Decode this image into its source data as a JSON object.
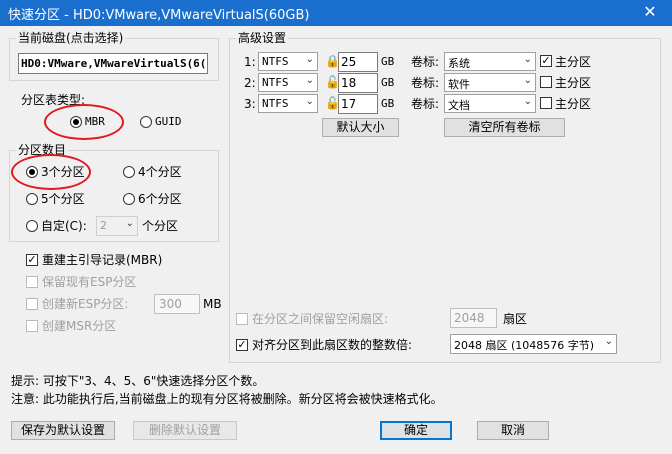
{
  "window": {
    "title": "快速分区 - HD0:VMware,VMwareVirtualS(60GB)",
    "close_icon": "close-icon"
  },
  "disk": {
    "group_label": "当前磁盘(点击选择)",
    "value": "HD0:VMware,VMwareVirtualS(6("
  },
  "partition_table": {
    "label": "分区表类型:",
    "mbr": "MBR",
    "guid": "GUID"
  },
  "partition_count": {
    "label": "分区数目",
    "opt3": "3个分区",
    "opt4": "4个分区",
    "opt5": "5个分区",
    "opt6": "6个分区",
    "custom": "自定(C):",
    "custom_value": "2",
    "custom_suffix": "个分区"
  },
  "options": {
    "rebuild_mbr": "重建主引导记录(MBR)",
    "keep_esp": "保留现有ESP分区",
    "create_esp": "创建新ESP分区:",
    "esp_size": "300",
    "esp_unit": "MB",
    "create_msr": "创建MSR分区"
  },
  "advanced": {
    "label": "高级设置",
    "unit": "GB",
    "vol_label": "卷标:",
    "primary": "主分区",
    "rows": [
      {
        "idx": "1:",
        "fs": "NTFS",
        "size": "25",
        "name": "系统",
        "primary_checked": true
      },
      {
        "idx": "2:",
        "fs": "NTFS",
        "size": "18",
        "name": "软件",
        "primary_checked": false
      },
      {
        "idx": "3:",
        "fs": "NTFS",
        "size": "17",
        "name": "文档",
        "primary_checked": false
      }
    ],
    "default_size_button": "默认大小",
    "clear_labels_button": "清空所有卷标"
  },
  "align": {
    "reserve_label": "在分区之间保留空闲扇区:",
    "reserve_value": "2048",
    "reserve_unit": "扇区",
    "align_label": "对齐分区到此扇区数的整数倍:",
    "align_value": "2048 扇区 (1048576 字节)"
  },
  "tips": {
    "tip": "提示: 可按下\"3、4、5、6\"快速选择分区个数。",
    "note": "注意: 此功能执行后,当前磁盘上的现有分区将被删除。新分区将会被快速格式化。"
  },
  "buttons": {
    "save_default": "保存为默认设置",
    "delete_default": "删除默认设置",
    "ok": "确定",
    "cancel": "取消"
  }
}
